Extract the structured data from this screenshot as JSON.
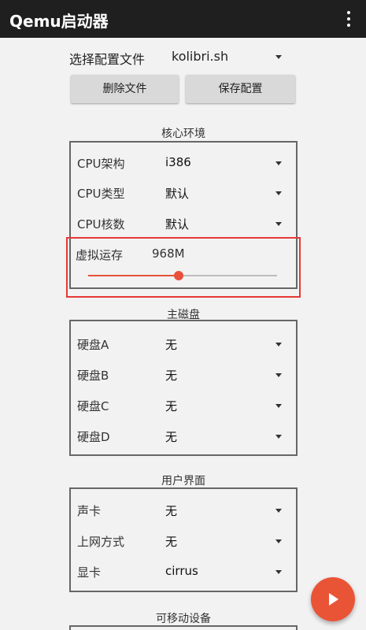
{
  "appbar": {
    "title": "Qemu启动器",
    "menu_icon": "more-vert-icon"
  },
  "config": {
    "label": "选择配置文件",
    "value": "kolibri.sh"
  },
  "buttons": {
    "delete": "删除文件",
    "save": "保存配置"
  },
  "core": {
    "title": "核心环境",
    "fields": [
      {
        "label": "CPU架构",
        "value": "i386"
      },
      {
        "label": "CPU类型",
        "value": "默认"
      },
      {
        "label": "CPU核数",
        "value": "默认"
      }
    ],
    "memory": {
      "label": "虚拟运存",
      "value": "968M",
      "fraction": 0.48
    }
  },
  "disks": {
    "title": "主磁盘",
    "fields": [
      {
        "label": "硬盘A",
        "value": "无"
      },
      {
        "label": "硬盘B",
        "value": "无"
      },
      {
        "label": "硬盘C",
        "value": "无"
      },
      {
        "label": "硬盘D",
        "value": "无"
      }
    ]
  },
  "ui": {
    "title": "用户界面",
    "fields": [
      {
        "label": "声卡",
        "value": "无"
      },
      {
        "label": "上网方式",
        "value": "无"
      },
      {
        "label": "显卡",
        "value": "cirrus"
      }
    ]
  },
  "removable": {
    "title": "可移动设备"
  },
  "fab": {
    "icon": "play-icon"
  },
  "colors": {
    "appbar": "#1f1f1f",
    "accent": "#e8503a",
    "highlight": "#e53935"
  }
}
